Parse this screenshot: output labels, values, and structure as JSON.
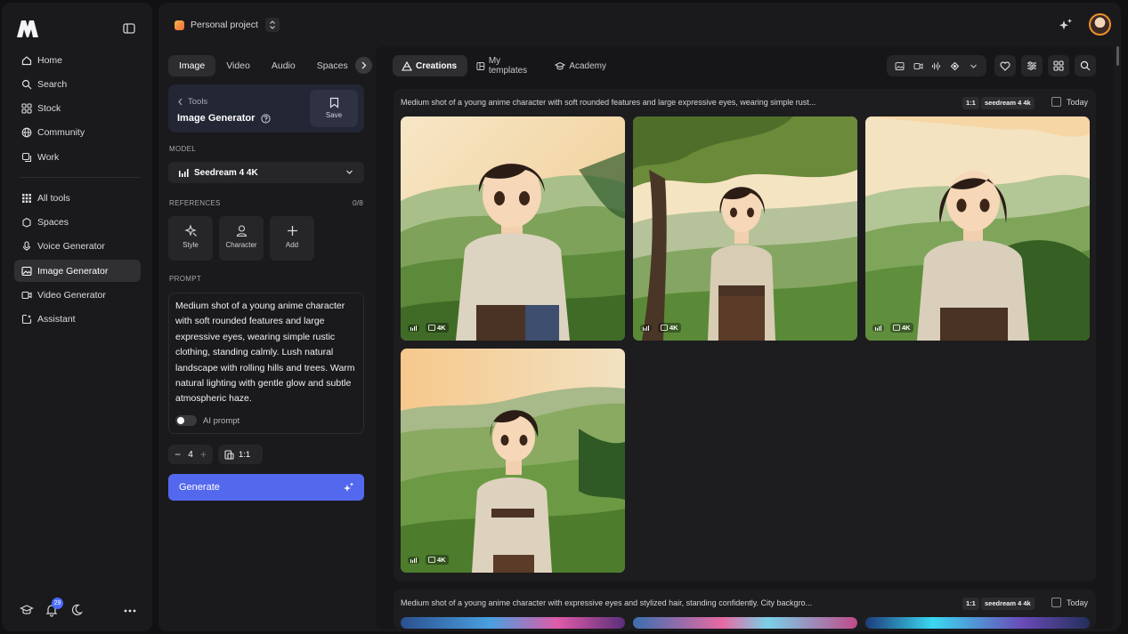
{
  "sidebar": {
    "nav": [
      {
        "label": "Home",
        "icon": "home-icon"
      },
      {
        "label": "Search",
        "icon": "search-icon"
      },
      {
        "label": "Stock",
        "icon": "stock-icon"
      },
      {
        "label": "Community",
        "icon": "globe-icon"
      },
      {
        "label": "Work",
        "icon": "work-icon"
      }
    ],
    "tools": [
      {
        "label": "All tools",
        "icon": "grid-icon"
      },
      {
        "label": "Spaces",
        "icon": "spaces-icon"
      },
      {
        "label": "Voice Generator",
        "icon": "mic-icon"
      },
      {
        "label": "Image Generator",
        "icon": "image-icon",
        "active": true
      },
      {
        "label": "Video Generator",
        "icon": "video-icon"
      },
      {
        "label": "Assistant",
        "icon": "assistant-icon"
      }
    ],
    "notifications_count": "29"
  },
  "header": {
    "project_name": "Personal project"
  },
  "controls": {
    "media_tabs": [
      "Image",
      "Video",
      "Audio",
      "Spaces"
    ],
    "active_media_tab": "Image",
    "tool_back": "Tools",
    "tool_name": "Image Generator",
    "save_label": "Save",
    "model_label": "MODEL",
    "model_value": "Seedream 4 4K",
    "references_label": "REFERENCES",
    "references_count": "0/8",
    "reference_tiles": [
      "Style",
      "Character",
      "Add"
    ],
    "prompt_label": "PROMPT",
    "prompt_text": "Medium shot of a young anime character with soft rounded features and large expressive eyes, wearing simple rustic clothing, standing calmly. Lush natural landscape with rolling hills and trees. Warm natural lighting with gentle glow and subtle atmospheric haze.",
    "ai_prompt_label": "AI prompt",
    "ai_prompt_on": false,
    "quantity": "4",
    "ratio": "1:1",
    "generate_label": "Generate"
  },
  "gallery": {
    "tabs": [
      "Creations",
      "My templates",
      "Academy"
    ],
    "active_tab": "Creations",
    "groups": [
      {
        "prompt": "Medium shot of a young anime character with soft rounded features and large expressive eyes, wearing simple rust...",
        "ratio": "1:1",
        "model": "seedream 4 4k",
        "date": "Today",
        "badge": "4K"
      },
      {
        "prompt": "Medium shot of a young anime character with expressive eyes and stylized hair, standing confidently. City backgro...",
        "ratio": "1:1",
        "model": "seedream 4 4k",
        "date": "Today"
      }
    ]
  },
  "colors": {
    "accent": "#5468ee",
    "notification_badge": "#4b6bff",
    "avatar_ring": "#f0902a"
  }
}
